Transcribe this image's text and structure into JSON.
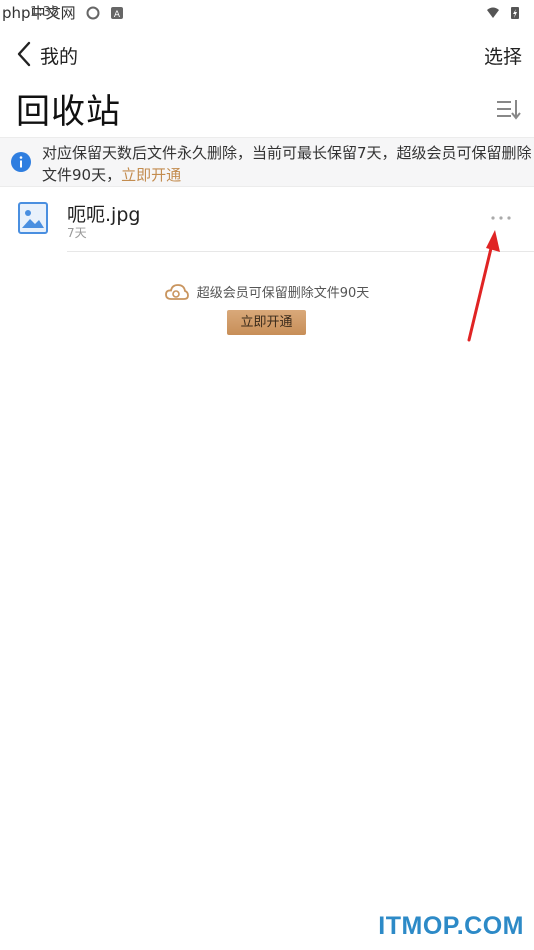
{
  "status_bar": {
    "time": "1:38",
    "watermark": "中文网",
    "watermark_brand": "php"
  },
  "nav": {
    "back_label": "我的",
    "select_label": "选择"
  },
  "page": {
    "title": "回收站"
  },
  "notice": {
    "text": "对应保留天数后文件永久删除，当前可最长保留7天，超级会员可保留删除文件90天，",
    "link": "立即开通"
  },
  "files": [
    {
      "name": "呃呃.jpg",
      "meta": "7天"
    }
  ],
  "promo": {
    "text": "超级会员可保留删除文件90天",
    "button": "立即开通"
  },
  "footer_watermark": "ITMOP.COM",
  "colors": {
    "accent_link": "#c38c4f",
    "promo_button": "#c78e58",
    "info_blue": "#2f7ee0",
    "annotation_red": "#e02424"
  }
}
